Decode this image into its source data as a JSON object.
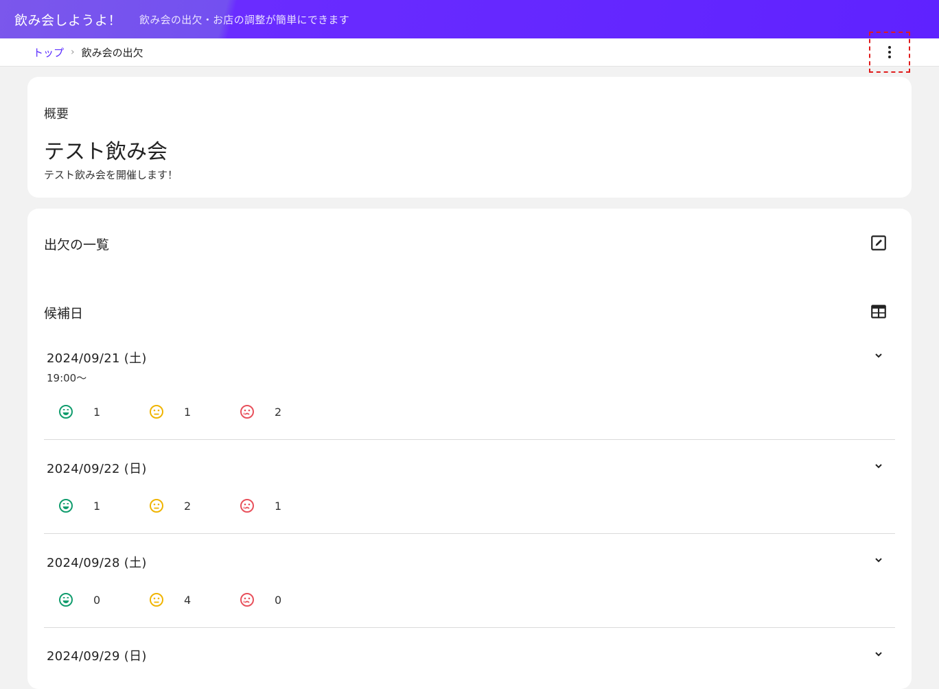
{
  "header": {
    "title": "飲み会しようよ！",
    "subtitle": "飲み会の出欠・お店の調整が簡単にできます"
  },
  "breadcrumb": {
    "home": "トップ",
    "current": "飲み会の出欠"
  },
  "summary": {
    "label": "概要",
    "title": "テスト飲み会",
    "description": "テスト飲み会を開催します！"
  },
  "attendance": {
    "title": "出欠の一覧",
    "candidates_title": "候補日",
    "dates": [
      {
        "date": "2024/09/21 (土)",
        "time": "19:00～",
        "ok": "1",
        "maybe": "1",
        "ng": "2"
      },
      {
        "date": "2024/09/22 (日)",
        "time": "",
        "ok": "1",
        "maybe": "2",
        "ng": "1"
      },
      {
        "date": "2024/09/28 (土)",
        "time": "",
        "ok": "0",
        "maybe": "4",
        "ng": "0"
      },
      {
        "date": "2024/09/29 (日)",
        "time": "",
        "ok": "",
        "maybe": "",
        "ng": ""
      }
    ]
  },
  "colors": {
    "accent": "#5a2cff",
    "ok": "#109c6d",
    "maybe": "#f0b400",
    "ng": "#e8505b"
  },
  "icons": [
    "more-vert-icon",
    "edit-icon",
    "table-icon",
    "chevron-down-icon",
    "smile-icon",
    "neutral-icon",
    "sad-icon"
  ]
}
